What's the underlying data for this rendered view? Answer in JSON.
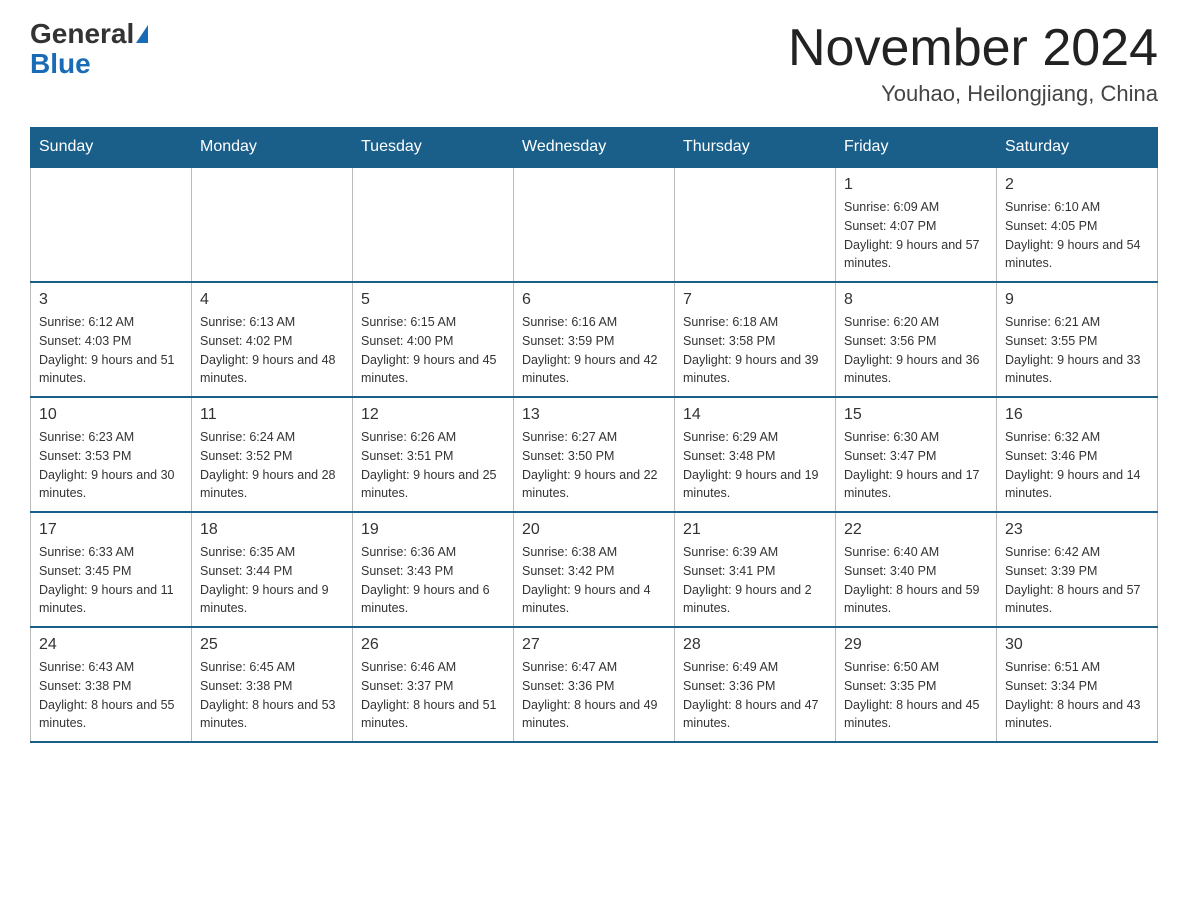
{
  "header": {
    "logo_main": "General",
    "logo_blue": "Blue",
    "month_title": "November 2024",
    "location": "Youhao, Heilongjiang, China"
  },
  "weekdays": [
    "Sunday",
    "Monday",
    "Tuesday",
    "Wednesday",
    "Thursday",
    "Friday",
    "Saturday"
  ],
  "weeks": [
    [
      {
        "day": "",
        "info": ""
      },
      {
        "day": "",
        "info": ""
      },
      {
        "day": "",
        "info": ""
      },
      {
        "day": "",
        "info": ""
      },
      {
        "day": "",
        "info": ""
      },
      {
        "day": "1",
        "info": "Sunrise: 6:09 AM\nSunset: 4:07 PM\nDaylight: 9 hours and 57 minutes."
      },
      {
        "day": "2",
        "info": "Sunrise: 6:10 AM\nSunset: 4:05 PM\nDaylight: 9 hours and 54 minutes."
      }
    ],
    [
      {
        "day": "3",
        "info": "Sunrise: 6:12 AM\nSunset: 4:03 PM\nDaylight: 9 hours and 51 minutes."
      },
      {
        "day": "4",
        "info": "Sunrise: 6:13 AM\nSunset: 4:02 PM\nDaylight: 9 hours and 48 minutes."
      },
      {
        "day": "5",
        "info": "Sunrise: 6:15 AM\nSunset: 4:00 PM\nDaylight: 9 hours and 45 minutes."
      },
      {
        "day": "6",
        "info": "Sunrise: 6:16 AM\nSunset: 3:59 PM\nDaylight: 9 hours and 42 minutes."
      },
      {
        "day": "7",
        "info": "Sunrise: 6:18 AM\nSunset: 3:58 PM\nDaylight: 9 hours and 39 minutes."
      },
      {
        "day": "8",
        "info": "Sunrise: 6:20 AM\nSunset: 3:56 PM\nDaylight: 9 hours and 36 minutes."
      },
      {
        "day": "9",
        "info": "Sunrise: 6:21 AM\nSunset: 3:55 PM\nDaylight: 9 hours and 33 minutes."
      }
    ],
    [
      {
        "day": "10",
        "info": "Sunrise: 6:23 AM\nSunset: 3:53 PM\nDaylight: 9 hours and 30 minutes."
      },
      {
        "day": "11",
        "info": "Sunrise: 6:24 AM\nSunset: 3:52 PM\nDaylight: 9 hours and 28 minutes."
      },
      {
        "day": "12",
        "info": "Sunrise: 6:26 AM\nSunset: 3:51 PM\nDaylight: 9 hours and 25 minutes."
      },
      {
        "day": "13",
        "info": "Sunrise: 6:27 AM\nSunset: 3:50 PM\nDaylight: 9 hours and 22 minutes."
      },
      {
        "day": "14",
        "info": "Sunrise: 6:29 AM\nSunset: 3:48 PM\nDaylight: 9 hours and 19 minutes."
      },
      {
        "day": "15",
        "info": "Sunrise: 6:30 AM\nSunset: 3:47 PM\nDaylight: 9 hours and 17 minutes."
      },
      {
        "day": "16",
        "info": "Sunrise: 6:32 AM\nSunset: 3:46 PM\nDaylight: 9 hours and 14 minutes."
      }
    ],
    [
      {
        "day": "17",
        "info": "Sunrise: 6:33 AM\nSunset: 3:45 PM\nDaylight: 9 hours and 11 minutes."
      },
      {
        "day": "18",
        "info": "Sunrise: 6:35 AM\nSunset: 3:44 PM\nDaylight: 9 hours and 9 minutes."
      },
      {
        "day": "19",
        "info": "Sunrise: 6:36 AM\nSunset: 3:43 PM\nDaylight: 9 hours and 6 minutes."
      },
      {
        "day": "20",
        "info": "Sunrise: 6:38 AM\nSunset: 3:42 PM\nDaylight: 9 hours and 4 minutes."
      },
      {
        "day": "21",
        "info": "Sunrise: 6:39 AM\nSunset: 3:41 PM\nDaylight: 9 hours and 2 minutes."
      },
      {
        "day": "22",
        "info": "Sunrise: 6:40 AM\nSunset: 3:40 PM\nDaylight: 8 hours and 59 minutes."
      },
      {
        "day": "23",
        "info": "Sunrise: 6:42 AM\nSunset: 3:39 PM\nDaylight: 8 hours and 57 minutes."
      }
    ],
    [
      {
        "day": "24",
        "info": "Sunrise: 6:43 AM\nSunset: 3:38 PM\nDaylight: 8 hours and 55 minutes."
      },
      {
        "day": "25",
        "info": "Sunrise: 6:45 AM\nSunset: 3:38 PM\nDaylight: 8 hours and 53 minutes."
      },
      {
        "day": "26",
        "info": "Sunrise: 6:46 AM\nSunset: 3:37 PM\nDaylight: 8 hours and 51 minutes."
      },
      {
        "day": "27",
        "info": "Sunrise: 6:47 AM\nSunset: 3:36 PM\nDaylight: 8 hours and 49 minutes."
      },
      {
        "day": "28",
        "info": "Sunrise: 6:49 AM\nSunset: 3:36 PM\nDaylight: 8 hours and 47 minutes."
      },
      {
        "day": "29",
        "info": "Sunrise: 6:50 AM\nSunset: 3:35 PM\nDaylight: 8 hours and 45 minutes."
      },
      {
        "day": "30",
        "info": "Sunrise: 6:51 AM\nSunset: 3:34 PM\nDaylight: 8 hours and 43 minutes."
      }
    ]
  ]
}
